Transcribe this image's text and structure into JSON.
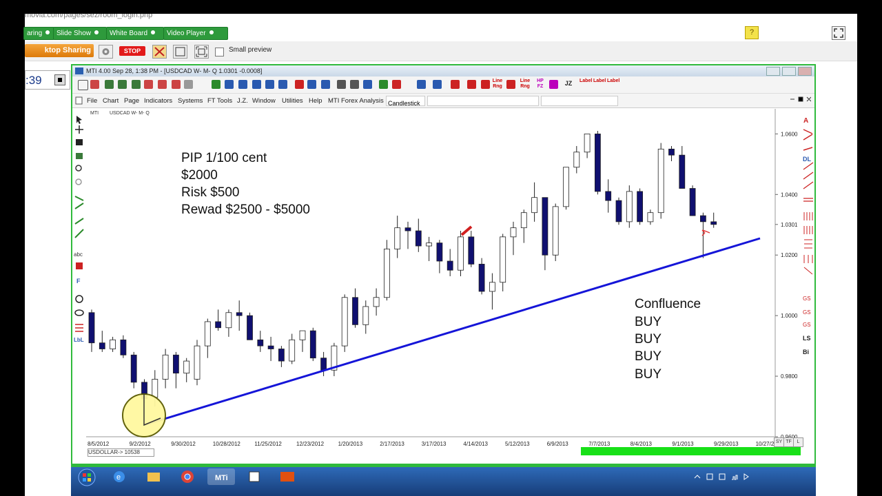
{
  "browser": {
    "url_fragment": "movia.com/pages/sez/room_login.php"
  },
  "room_bar": {
    "tabs": [
      {
        "label": "aring"
      },
      {
        "label": "Slide Show"
      },
      {
        "label": "White Board"
      },
      {
        "label": "Video Player"
      }
    ],
    "help_label": "?"
  },
  "sharing_bar": {
    "desktop_sharing_label": "ktop Sharing",
    "stop_label": "STOP",
    "small_preview_label": "Small preview"
  },
  "timer": {
    "value": ":39"
  },
  "mti_window": {
    "title": "MTI 4.00  Sep 28,  1:38 PM - [USDCAD W-  M- Q 1.0301   -0.0008]",
    "toolbar_text_buttons": [
      "Line Rng",
      "Line Rng",
      "HP FZ",
      "JZ",
      "Label",
      "Label",
      "Label"
    ],
    "menu": [
      "File",
      "Chart",
      "Page",
      "Indicators",
      "Systems",
      "FT Tools",
      "J.Z.",
      "Window",
      "Utilities",
      "Help",
      "MTI Forex Analysis"
    ],
    "chart_style_select": "Candlestick",
    "chart_header_label": "MTI",
    "chart_header_symbol": "USDCAD W-  M- Q",
    "status_symbol": "USDOLLAR->  10538",
    "right_tabs": [
      "SY",
      "TF",
      "L"
    ],
    "left_tool_labels": [
      "abc",
      "F",
      "LbL"
    ],
    "right_tool_labels": [
      "DL",
      "LS",
      "Bi"
    ]
  },
  "annotations": {
    "plan_lines": [
      "PIP 1/100 cent",
      "$2000",
      "Risk $500",
      "Rewad $2500 - $5000"
    ],
    "confluence_lines": [
      "Confluence",
      "BUY",
      "BUY",
      "BUY",
      "BUY"
    ]
  },
  "chart_data": {
    "type": "candlestick",
    "symbol": "USDCAD",
    "price_axis_labels": [
      "1.0600",
      "1.0400",
      "1.0301",
      "1.0200",
      "1.0000",
      "0.9800",
      "0.9600"
    ],
    "date_axis_labels": [
      "8/5/2012",
      "9/2/2012",
      "9/30/2012",
      "10/28/2012",
      "11/25/2012",
      "12/23/2012",
      "1/20/2013",
      "2/17/2013",
      "3/17/2013",
      "4/14/2013",
      "5/12/2013",
      "6/9/2013",
      "7/7/2013",
      "8/4/2013",
      "9/1/2013",
      "9/29/2013",
      "10/27/2013"
    ],
    "ylim": [
      0.96,
      1.066
    ],
    "last_price": 1.0301,
    "colors": {
      "up": "#ffffff",
      "down": "#101070",
      "trendline": "#1515d8"
    },
    "candles": [
      [
        1.001,
        1.002,
        0.988,
        0.991
      ],
      [
        0.991,
        0.995,
        0.988,
        0.989
      ],
      [
        0.989,
        0.993,
        0.988,
        0.992
      ],
      [
        0.992,
        0.9935,
        0.986,
        0.987
      ],
      [
        0.987,
        0.988,
        0.976,
        0.978
      ],
      [
        0.978,
        0.979,
        0.971,
        0.9725
      ],
      [
        0.973,
        0.982,
        0.97,
        0.979
      ],
      [
        0.979,
        0.989,
        0.976,
        0.987
      ],
      [
        0.987,
        0.988,
        0.976,
        0.981
      ],
      [
        0.981,
        0.986,
        0.978,
        0.985
      ],
      [
        0.979,
        0.992,
        0.977,
        0.99
      ],
      [
        0.99,
        0.999,
        0.986,
        0.998
      ],
      [
        0.998,
        1.002,
        0.995,
        0.996
      ],
      [
        0.996,
        1.002,
        0.993,
        1.001
      ],
      [
        1.001,
        1.005,
        0.995,
        1.0
      ],
      [
        1.0,
        1.001,
        0.992,
        0.992
      ],
      [
        0.992,
        0.995,
        0.988,
        0.99
      ],
      [
        0.99,
        0.993,
        0.985,
        0.989
      ],
      [
        0.989,
        0.99,
        0.983,
        0.985
      ],
      [
        0.985,
        0.994,
        0.984,
        0.992
      ],
      [
        0.992,
        0.995,
        0.988,
        0.995
      ],
      [
        0.995,
        0.996,
        0.985,
        0.986
      ],
      [
        0.986,
        0.988,
        0.98,
        0.982
      ],
      [
        0.982,
        0.991,
        0.98,
        0.99
      ],
      [
        0.99,
        1.007,
        0.988,
        1.006
      ],
      [
        1.006,
        1.009,
        0.996,
        0.997
      ],
      [
        0.997,
        1.005,
        0.994,
        1.003
      ],
      [
        1.003,
        1.009,
        1.0,
        1.006
      ],
      [
        1.006,
        1.025,
        1.005,
        1.022
      ],
      [
        1.022,
        1.033,
        1.019,
        1.029
      ],
      [
        1.029,
        1.031,
        1.022,
        1.028
      ],
      [
        1.028,
        1.032,
        1.021,
        1.023
      ],
      [
        1.023,
        1.026,
        1.018,
        1.024
      ],
      [
        1.024,
        1.025,
        1.014,
        1.018
      ],
      [
        1.018,
        1.022,
        1.013,
        1.015
      ],
      [
        1.015,
        1.028,
        1.013,
        1.026
      ],
      [
        1.026,
        1.028,
        1.016,
        1.017
      ],
      [
        1.017,
        1.019,
        1.007,
        1.008
      ],
      [
        1.008,
        1.014,
        1.002,
        1.011
      ],
      [
        1.011,
        1.027,
        1.008,
        1.026
      ],
      [
        1.026,
        1.031,
        1.02,
        1.029
      ],
      [
        1.029,
        1.035,
        1.024,
        1.034
      ],
      [
        1.034,
        1.044,
        1.031,
        1.039
      ],
      [
        1.039,
        1.038,
        1.015,
        1.02
      ],
      [
        1.02,
        1.037,
        1.018,
        1.036
      ],
      [
        1.036,
        1.048,
        1.035,
        1.049
      ],
      [
        1.049,
        1.056,
        1.047,
        1.054
      ],
      [
        1.054,
        1.06,
        1.052,
        1.06
      ],
      [
        1.06,
        1.061,
        1.04,
        1.041
      ],
      [
        1.041,
        1.045,
        1.034,
        1.038
      ],
      [
        1.038,
        1.039,
        1.03,
        1.031
      ],
      [
        1.031,
        1.043,
        1.029,
        1.041
      ],
      [
        1.041,
        1.042,
        1.03,
        1.031
      ],
      [
        1.031,
        1.035,
        1.03,
        1.034
      ],
      [
        1.034,
        1.057,
        1.032,
        1.055
      ],
      [
        1.055,
        1.056,
        1.051,
        1.053
      ],
      [
        1.053,
        1.056,
        1.042,
        1.042
      ],
      [
        1.042,
        1.043,
        1.033,
        1.033
      ],
      [
        1.033,
        1.034,
        1.019,
        1.031
      ],
      [
        1.031,
        1.034,
        1.029,
        1.0301
      ]
    ]
  }
}
